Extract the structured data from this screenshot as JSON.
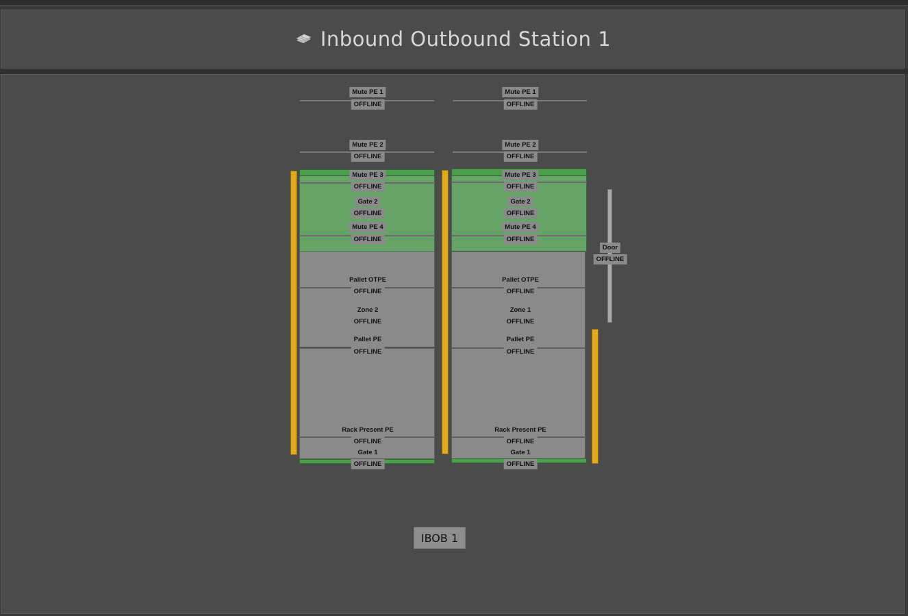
{
  "header": {
    "title": "Inbound Outbound Station 1",
    "icon": "layers-icon"
  },
  "lanes": [
    {
      "id": "left",
      "sensors": {
        "mute_pe_1": {
          "name": "Mute PE 1",
          "status": "OFFLINE"
        },
        "mute_pe_2": {
          "name": "Mute PE 2",
          "status": "OFFLINE"
        },
        "mute_pe_3": {
          "name": "Mute PE 3",
          "status": "OFFLINE"
        },
        "gate_2": {
          "name": "Gate 2",
          "status": "OFFLINE"
        },
        "mute_pe_4": {
          "name": "Mute PE 4",
          "status": "OFFLINE"
        },
        "pallet_otpe": {
          "name": "Pallet OTPE",
          "status": "OFFLINE"
        },
        "zone": {
          "name": "Zone 2",
          "status": "OFFLINE"
        },
        "pallet_pe": {
          "name": "Pallet PE",
          "status": "OFFLINE"
        },
        "rack_present_pe": {
          "name": "Rack Present PE",
          "status": "OFFLINE"
        },
        "gate_1": {
          "name": "Gate 1",
          "status": "OFFLINE"
        }
      }
    },
    {
      "id": "right",
      "sensors": {
        "mute_pe_1": {
          "name": "Mute PE 1",
          "status": "OFFLINE"
        },
        "mute_pe_2": {
          "name": "Mute PE 2",
          "status": "OFFLINE"
        },
        "mute_pe_3": {
          "name": "Mute PE 3",
          "status": "OFFLINE"
        },
        "gate_2": {
          "name": "Gate 2",
          "status": "OFFLINE"
        },
        "mute_pe_4": {
          "name": "Mute PE 4",
          "status": "OFFLINE"
        },
        "pallet_otpe": {
          "name": "Pallet OTPE",
          "status": "OFFLINE"
        },
        "zone": {
          "name": "Zone 1",
          "status": "OFFLINE"
        },
        "pallet_pe": {
          "name": "Pallet PE",
          "status": "OFFLINE"
        },
        "rack_present_pe": {
          "name": "Rack Present PE",
          "status": "OFFLINE"
        },
        "gate_1": {
          "name": "Gate 1",
          "status": "OFFLINE"
        }
      }
    }
  ],
  "door": {
    "name": "Door",
    "status": "OFFLINE"
  },
  "station_label": "IBOB 1",
  "colors": {
    "active_zone": "#65a366",
    "idle_zone": "#8a8a8a",
    "rail": "#e3a91c",
    "background": "#4b4b4b"
  }
}
